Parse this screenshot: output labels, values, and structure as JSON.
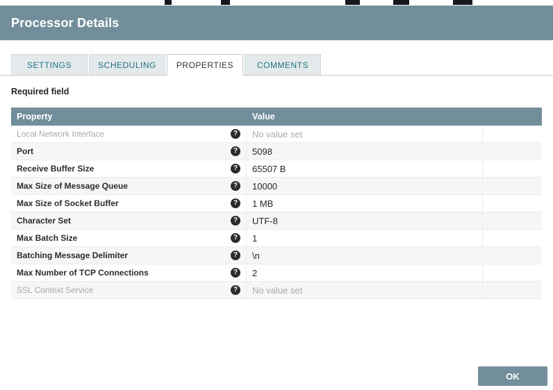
{
  "dialog": {
    "title": "Processor Details"
  },
  "tabs": [
    {
      "label": "SETTINGS",
      "active": false
    },
    {
      "label": "SCHEDULING",
      "active": false
    },
    {
      "label": "PROPERTIES",
      "active": true
    },
    {
      "label": "COMMENTS",
      "active": false
    }
  ],
  "required_field_label": "Required field",
  "table": {
    "headers": [
      "Property",
      "Value"
    ],
    "help_icon": "?",
    "rows": [
      {
        "property": "Local Network Interface",
        "value": "No value set",
        "unset": true
      },
      {
        "property": "Port",
        "value": "5098",
        "unset": false
      },
      {
        "property": "Receive Buffer Size",
        "value": "65507 B",
        "unset": false
      },
      {
        "property": "Max Size of Message Queue",
        "value": "10000",
        "unset": false
      },
      {
        "property": "Max Size of Socket Buffer",
        "value": "1 MB",
        "unset": false
      },
      {
        "property": "Character Set",
        "value": "UTF-8",
        "unset": false
      },
      {
        "property": "Max Batch Size",
        "value": "1",
        "unset": false
      },
      {
        "property": "Batching Message Delimiter",
        "value": "\\n",
        "unset": false
      },
      {
        "property": "Max Number of TCP Connections",
        "value": "2",
        "unset": false
      },
      {
        "property": "SSL Context Service",
        "value": "No value set",
        "unset": true
      }
    ]
  },
  "footer": {
    "ok_label": "OK"
  },
  "colors": {
    "header_bg": "#728e9b",
    "table_header_bg": "#728e9b",
    "ok_button_bg": "#728e9b",
    "tab_text": "#20707f",
    "unset_text": "#a9a9a9",
    "alt_row_bg": "#f4f6f7"
  }
}
